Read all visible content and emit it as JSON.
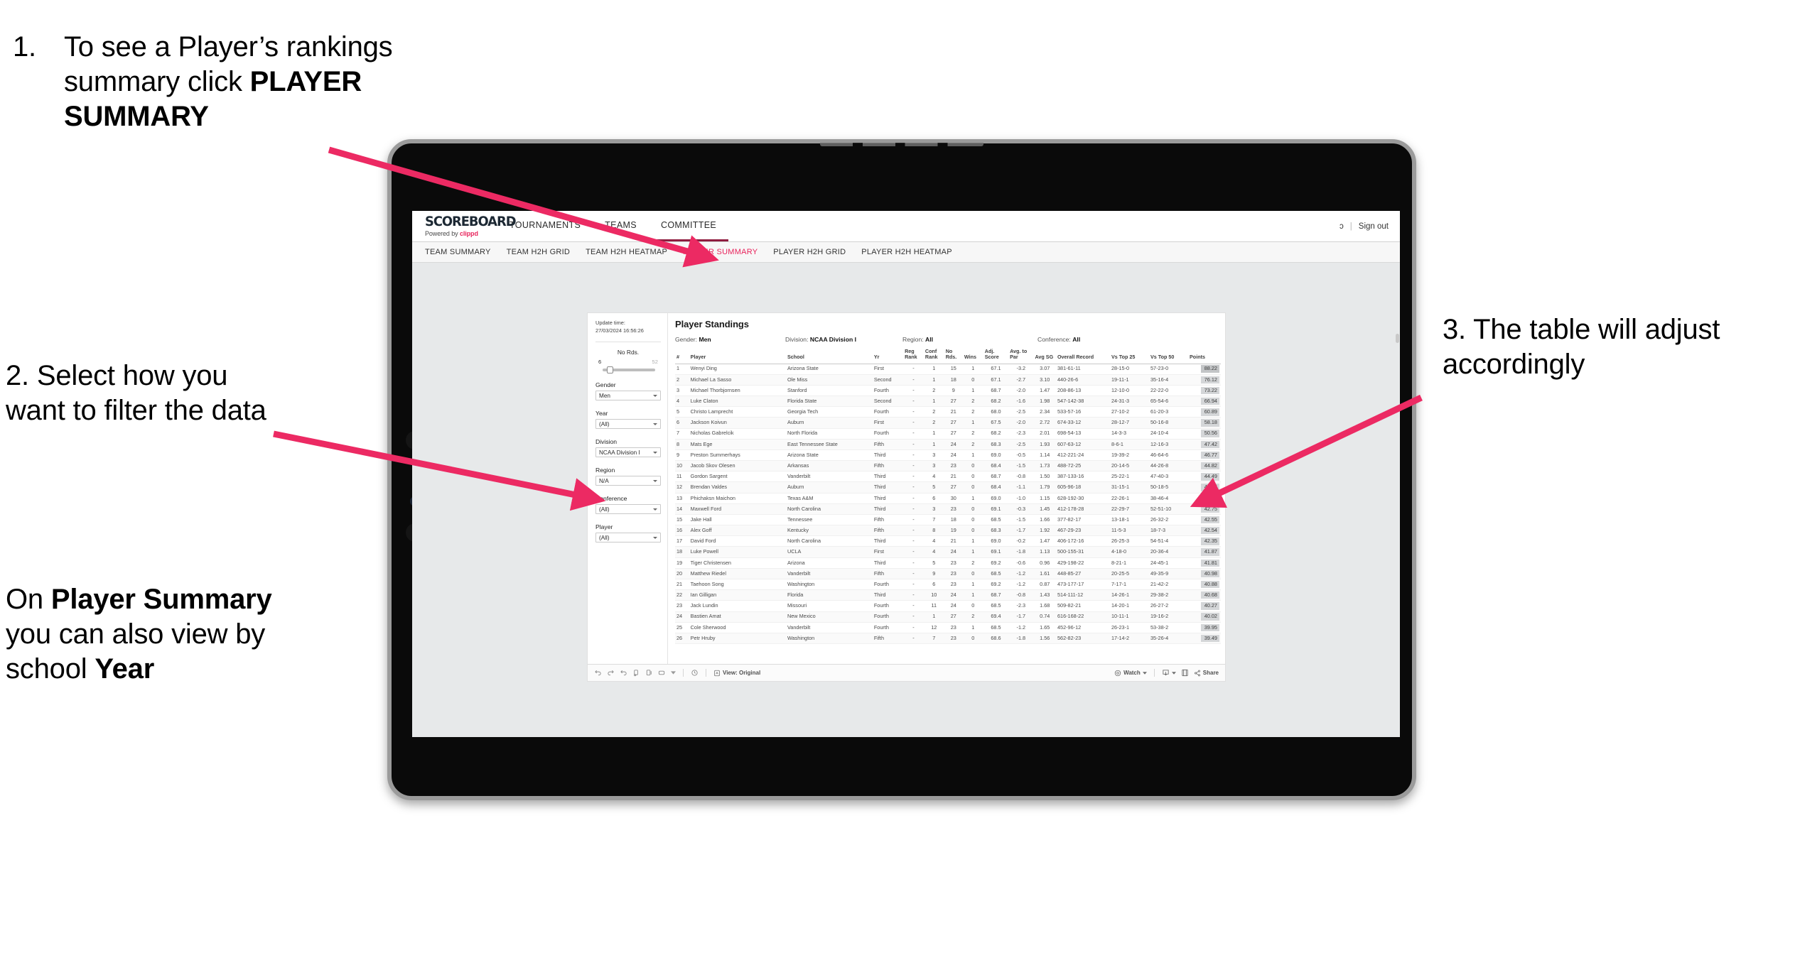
{
  "annotations": {
    "one": {
      "number": "1.",
      "line1": "To see a Player’s rankings",
      "line2_pre": "summary click ",
      "line2_bold": "PLAYER",
      "line3_bold": "SUMMARY"
    },
    "two": {
      "text": "2. Select how you want to filter the data"
    },
    "two_b": {
      "pre": "On ",
      "bold1": "Player Summary",
      "mid": " you can also view by school ",
      "bold2": "Year"
    },
    "three": {
      "text": "3. The table will adjust accordingly"
    },
    "accent_color": "#ec2a63"
  },
  "app": {
    "brand": {
      "logo": "SCOREBOARD",
      "powered_pre": "Powered by ",
      "powered_brand": "clippd"
    },
    "top_nav": [
      {
        "label": "TOURNAMENTS",
        "active": false
      },
      {
        "label": "TEAMS",
        "active": false
      },
      {
        "label": "COMMITTEE",
        "active": true
      }
    ],
    "top_right": {
      "user_glyph": "ɔ",
      "divider": "|",
      "sign_out": "Sign out"
    },
    "sub_nav": [
      {
        "label": "TEAM SUMMARY",
        "active": false
      },
      {
        "label": "TEAM H2H GRID",
        "active": false
      },
      {
        "label": "TEAM H2H HEATMAP",
        "active": false
      },
      {
        "label": "PLAYER SUMMARY",
        "active": true
      },
      {
        "label": "PLAYER H2H GRID",
        "active": false
      },
      {
        "label": "PLAYER H2H HEATMAP",
        "active": false
      }
    ],
    "active_accent": "#e8245c"
  },
  "filters": {
    "update_label": "Update time:",
    "update_value": "27/03/2024 16:56:26",
    "slider": {
      "label": "No Rds.",
      "min": "6",
      "max": "52",
      "value_pct": 8
    },
    "controls": [
      {
        "label": "Gender",
        "value": "Men"
      },
      {
        "label": "Year",
        "value": "(All)"
      },
      {
        "label": "Division",
        "value": "NCAA Division I"
      },
      {
        "label": "Region",
        "value": "N/A"
      },
      {
        "label": "Conference",
        "value": "(All)"
      },
      {
        "label": "Player",
        "value": "(All)"
      }
    ]
  },
  "panel": {
    "title": "Player Standings",
    "meta": [
      {
        "label": "Gender: ",
        "value": "Men"
      },
      {
        "label": "Division: ",
        "value": "NCAA Division I"
      },
      {
        "label": "Region: ",
        "value": "All"
      },
      {
        "label": "Conference: ",
        "value": "All"
      }
    ],
    "columns": [
      "#",
      "Player",
      "School",
      "Yr",
      "Reg Rank",
      "Conf Rank",
      "No Rds.",
      "Wins",
      "Adj. Score",
      "Avg. to Par",
      "Avg SG",
      "Overall Record",
      "Vs Top 25",
      "Vs Top 50",
      "Points"
    ],
    "rows": [
      {
        "num": "1",
        "player": "Wenyi Ding",
        "school": "Arizona State",
        "yr": "First",
        "reg": "-",
        "conf": "1",
        "rds": "15",
        "wins": "1",
        "adj": "67.1",
        "par": "-3.2",
        "sg": "3.07",
        "ovr": "381-61-11",
        "t25": "28-15-0",
        "t50": "57-23-0",
        "pts": "88.22"
      },
      {
        "num": "2",
        "player": "Michael La Sasso",
        "school": "Ole Miss",
        "yr": "Second",
        "reg": "-",
        "conf": "1",
        "rds": "18",
        "wins": "0",
        "adj": "67.1",
        "par": "-2.7",
        "sg": "3.10",
        "ovr": "440-26-6",
        "t25": "19-11-1",
        "t50": "35-16-4",
        "pts": "76.12"
      },
      {
        "num": "3",
        "player": "Michael Thorbjornsen",
        "school": "Stanford",
        "yr": "Fourth",
        "reg": "-",
        "conf": "2",
        "rds": "9",
        "wins": "1",
        "adj": "68.7",
        "par": "-2.0",
        "sg": "1.47",
        "ovr": "208-86-13",
        "t25": "12-10-0",
        "t50": "22-22-0",
        "pts": "73.22"
      },
      {
        "num": "4",
        "player": "Luke Claton",
        "school": "Florida State",
        "yr": "Second",
        "reg": "-",
        "conf": "1",
        "rds": "27",
        "wins": "2",
        "adj": "68.2",
        "par": "-1.6",
        "sg": "1.98",
        "ovr": "547-142-38",
        "t25": "24-31-3",
        "t50": "65-54-6",
        "pts": "66.94"
      },
      {
        "num": "5",
        "player": "Christo Lamprecht",
        "school": "Georgia Tech",
        "yr": "Fourth",
        "reg": "-",
        "conf": "2",
        "rds": "21",
        "wins": "2",
        "adj": "68.0",
        "par": "-2.5",
        "sg": "2.34",
        "ovr": "533-57-16",
        "t25": "27-10-2",
        "t50": "61-20-3",
        "pts": "60.89"
      },
      {
        "num": "6",
        "player": "Jackson Koivun",
        "school": "Auburn",
        "yr": "First",
        "reg": "-",
        "conf": "2",
        "rds": "27",
        "wins": "1",
        "adj": "67.5",
        "par": "-2.0",
        "sg": "2.72",
        "ovr": "674-33-12",
        "t25": "28-12-7",
        "t50": "50-16-8",
        "pts": "58.18"
      },
      {
        "num": "7",
        "player": "Nicholas Gabrelcik",
        "school": "North Florida",
        "yr": "Fourth",
        "reg": "-",
        "conf": "1",
        "rds": "27",
        "wins": "2",
        "adj": "68.2",
        "par": "-2.3",
        "sg": "2.01",
        "ovr": "698-54-13",
        "t25": "14-3-3",
        "t50": "24-10-4",
        "pts": "50.56"
      },
      {
        "num": "8",
        "player": "Mats Ege",
        "school": "East Tennessee State",
        "yr": "Fifth",
        "reg": "-",
        "conf": "1",
        "rds": "24",
        "wins": "2",
        "adj": "68.3",
        "par": "-2.5",
        "sg": "1.93",
        "ovr": "607-63-12",
        "t25": "8-6-1",
        "t50": "12-16-3",
        "pts": "47.42"
      },
      {
        "num": "9",
        "player": "Preston Summerhays",
        "school": "Arizona State",
        "yr": "Third",
        "reg": "-",
        "conf": "3",
        "rds": "24",
        "wins": "1",
        "adj": "69.0",
        "par": "-0.5",
        "sg": "1.14",
        "ovr": "412-221-24",
        "t25": "19-39-2",
        "t50": "46-64-6",
        "pts": "46.77"
      },
      {
        "num": "10",
        "player": "Jacob Skov Olesen",
        "school": "Arkansas",
        "yr": "Fifth",
        "reg": "-",
        "conf": "3",
        "rds": "23",
        "wins": "0",
        "adj": "68.4",
        "par": "-1.5",
        "sg": "1.73",
        "ovr": "488-72-25",
        "t25": "20-14-5",
        "t50": "44-26-8",
        "pts": "44.82"
      },
      {
        "num": "11",
        "player": "Gordon Sargent",
        "school": "Vanderbilt",
        "yr": "Third",
        "reg": "-",
        "conf": "4",
        "rds": "21",
        "wins": "0",
        "adj": "68.7",
        "par": "-0.8",
        "sg": "1.50",
        "ovr": "387-133-16",
        "t25": "25-22-1",
        "t50": "47-40-3",
        "pts": "44.49"
      },
      {
        "num": "12",
        "player": "Brendan Valdes",
        "school": "Auburn",
        "yr": "Third",
        "reg": "-",
        "conf": "5",
        "rds": "27",
        "wins": "0",
        "adj": "68.4",
        "par": "-1.1",
        "sg": "1.79",
        "ovr": "605-96-18",
        "t25": "31-15-1",
        "t50": "50-18-5",
        "pts": "43.95"
      },
      {
        "num": "13",
        "player": "Phichaksn Maichon",
        "school": "Texas A&M",
        "yr": "Third",
        "reg": "-",
        "conf": "6",
        "rds": "30",
        "wins": "1",
        "adj": "69.0",
        "par": "-1.0",
        "sg": "1.15",
        "ovr": "628-192-30",
        "t25": "22-26-1",
        "t50": "38-46-4",
        "pts": "43.83"
      },
      {
        "num": "14",
        "player": "Maxwell Ford",
        "school": "North Carolina",
        "yr": "Third",
        "reg": "-",
        "conf": "3",
        "rds": "23",
        "wins": "0",
        "adj": "69.1",
        "par": "-0.3",
        "sg": "1.45",
        "ovr": "412-178-28",
        "t25": "22-29-7",
        "t50": "52-51-10",
        "pts": "42.75"
      },
      {
        "num": "15",
        "player": "Jake Hall",
        "school": "Tennessee",
        "yr": "Fifth",
        "reg": "-",
        "conf": "7",
        "rds": "18",
        "wins": "0",
        "adj": "68.5",
        "par": "-1.5",
        "sg": "1.66",
        "ovr": "377-82-17",
        "t25": "13-18-1",
        "t50": "26-32-2",
        "pts": "42.55"
      },
      {
        "num": "16",
        "player": "Alex Goff",
        "school": "Kentucky",
        "yr": "Fifth",
        "reg": "-",
        "conf": "8",
        "rds": "19",
        "wins": "0",
        "adj": "68.3",
        "par": "-1.7",
        "sg": "1.92",
        "ovr": "467-29-23",
        "t25": "11-5-3",
        "t50": "18-7-3",
        "pts": "42.54"
      },
      {
        "num": "17",
        "player": "David Ford",
        "school": "North Carolina",
        "yr": "Third",
        "reg": "-",
        "conf": "4",
        "rds": "21",
        "wins": "1",
        "adj": "69.0",
        "par": "-0.2",
        "sg": "1.47",
        "ovr": "406-172-16",
        "t25": "26-25-3",
        "t50": "54-51-4",
        "pts": "42.35"
      },
      {
        "num": "18",
        "player": "Luke Powell",
        "school": "UCLA",
        "yr": "First",
        "reg": "-",
        "conf": "4",
        "rds": "24",
        "wins": "1",
        "adj": "69.1",
        "par": "-1.8",
        "sg": "1.13",
        "ovr": "500-155-31",
        "t25": "4-18-0",
        "t50": "20-36-4",
        "pts": "41.87"
      },
      {
        "num": "19",
        "player": "Tiger Christensen",
        "school": "Arizona",
        "yr": "Third",
        "reg": "-",
        "conf": "5",
        "rds": "23",
        "wins": "2",
        "adj": "69.2",
        "par": "-0.6",
        "sg": "0.96",
        "ovr": "429-198-22",
        "t25": "8-21-1",
        "t50": "24-45-1",
        "pts": "41.81"
      },
      {
        "num": "20",
        "player": "Matthew Riedel",
        "school": "Vanderbilt",
        "yr": "Fifth",
        "reg": "-",
        "conf": "9",
        "rds": "23",
        "wins": "0",
        "adj": "68.5",
        "par": "-1.2",
        "sg": "1.61",
        "ovr": "448-85-27",
        "t25": "20-25-5",
        "t50": "49-35-9",
        "pts": "40.98"
      },
      {
        "num": "21",
        "player": "Taehoon Song",
        "school": "Washington",
        "yr": "Fourth",
        "reg": "-",
        "conf": "6",
        "rds": "23",
        "wins": "1",
        "adj": "69.2",
        "par": "-1.2",
        "sg": "0.87",
        "ovr": "473-177-17",
        "t25": "7-17-1",
        "t50": "21-42-2",
        "pts": "40.88"
      },
      {
        "num": "22",
        "player": "Ian Gilligan",
        "school": "Florida",
        "yr": "Third",
        "reg": "-",
        "conf": "10",
        "rds": "24",
        "wins": "1",
        "adj": "68.7",
        "par": "-0.8",
        "sg": "1.43",
        "ovr": "514-111-12",
        "t25": "14-26-1",
        "t50": "29-38-2",
        "pts": "40.68"
      },
      {
        "num": "23",
        "player": "Jack Lundin",
        "school": "Missouri",
        "yr": "Fourth",
        "reg": "-",
        "conf": "11",
        "rds": "24",
        "wins": "0",
        "adj": "68.5",
        "par": "-2.3",
        "sg": "1.68",
        "ovr": "509-82-21",
        "t25": "14-20-1",
        "t50": "26-27-2",
        "pts": "40.27"
      },
      {
        "num": "24",
        "player": "Bastien Amat",
        "school": "New Mexico",
        "yr": "Fourth",
        "reg": "-",
        "conf": "1",
        "rds": "27",
        "wins": "2",
        "adj": "69.4",
        "par": "-1.7",
        "sg": "0.74",
        "ovr": "616-168-22",
        "t25": "10-11-1",
        "t50": "19-16-2",
        "pts": "40.02"
      },
      {
        "num": "25",
        "player": "Cole Sherwood",
        "school": "Vanderbilt",
        "yr": "Fourth",
        "reg": "-",
        "conf": "12",
        "rds": "23",
        "wins": "1",
        "adj": "68.5",
        "par": "-1.2",
        "sg": "1.65",
        "ovr": "452-96-12",
        "t25": "26-23-1",
        "t50": "53-38-2",
        "pts": "39.95"
      },
      {
        "num": "26",
        "player": "Petr Hruby",
        "school": "Washington",
        "yr": "Fifth",
        "reg": "-",
        "conf": "7",
        "rds": "23",
        "wins": "0",
        "adj": "68.6",
        "par": "-1.8",
        "sg": "1.56",
        "ovr": "562-82-23",
        "t25": "17-14-2",
        "t50": "35-26-4",
        "pts": "39.49"
      }
    ]
  },
  "toolbar": {
    "view_label": "View: Original",
    "watch_label": "Watch",
    "share_label": "Share"
  }
}
